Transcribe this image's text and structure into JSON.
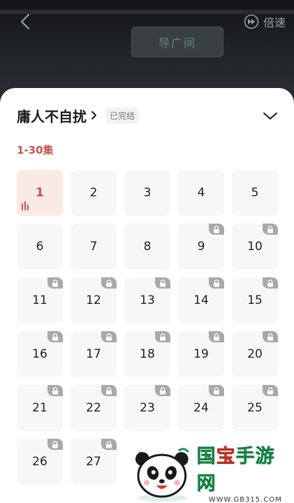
{
  "video": {
    "sign_text": "导广间",
    "speed_label": "倍速"
  },
  "series": {
    "title": "庸人不自扰",
    "status": "已完结",
    "range_tab": "1-30集",
    "current_episode": "1"
  },
  "episodes": [
    {
      "label": "1",
      "locked": false,
      "active": true
    },
    {
      "label": "2",
      "locked": false
    },
    {
      "label": "3",
      "locked": false
    },
    {
      "label": "4",
      "locked": false
    },
    {
      "label": "5",
      "locked": false
    },
    {
      "label": "6",
      "locked": false
    },
    {
      "label": "7",
      "locked": false
    },
    {
      "label": "8",
      "locked": false
    },
    {
      "label": "9",
      "locked": true
    },
    {
      "label": "10",
      "locked": true
    },
    {
      "label": "11",
      "locked": true
    },
    {
      "label": "12",
      "locked": true
    },
    {
      "label": "13",
      "locked": true
    },
    {
      "label": "14",
      "locked": true
    },
    {
      "label": "15",
      "locked": true
    },
    {
      "label": "16",
      "locked": true
    },
    {
      "label": "17",
      "locked": true
    },
    {
      "label": "18",
      "locked": true
    },
    {
      "label": "19",
      "locked": true
    },
    {
      "label": "20",
      "locked": true
    },
    {
      "label": "21",
      "locked": true
    },
    {
      "label": "22",
      "locked": true
    },
    {
      "label": "23",
      "locked": true
    },
    {
      "label": "24",
      "locked": true
    },
    {
      "label": "25",
      "locked": true
    },
    {
      "label": "26",
      "locked": true
    },
    {
      "label": "27",
      "locked": true
    }
  ],
  "watermark": {
    "brand_a": "国",
    "brand_b": "宝",
    "brand_c": "手游网",
    "url": "WWW.GB315.COM"
  },
  "colors": {
    "accent": "#c4584c",
    "active_bg": "#fbe9e6",
    "lock_bg": "#a9a9a9",
    "cell_bg": "#f7f7f7"
  },
  "icons": {
    "back": "back-arrow-icon",
    "speed": "fast-forward-circle-icon",
    "title_chevron": "chevron-right-icon",
    "collapse": "chevron-down-icon",
    "lock": "lock-icon",
    "playing": "equalizer-icon"
  }
}
